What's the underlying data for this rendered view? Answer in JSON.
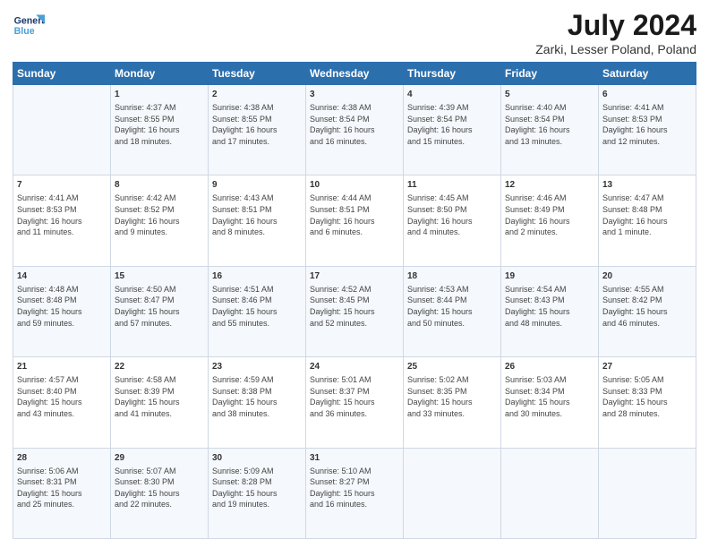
{
  "header": {
    "logo_line1": "General",
    "logo_line2": "Blue",
    "title": "July 2024",
    "subtitle": "Zarki, Lesser Poland, Poland"
  },
  "days_of_week": [
    "Sunday",
    "Monday",
    "Tuesday",
    "Wednesday",
    "Thursday",
    "Friday",
    "Saturday"
  ],
  "weeks": [
    [
      {
        "day": "",
        "content": ""
      },
      {
        "day": "1",
        "content": "Sunrise: 4:37 AM\nSunset: 8:55 PM\nDaylight: 16 hours\nand 18 minutes."
      },
      {
        "day": "2",
        "content": "Sunrise: 4:38 AM\nSunset: 8:55 PM\nDaylight: 16 hours\nand 17 minutes."
      },
      {
        "day": "3",
        "content": "Sunrise: 4:38 AM\nSunset: 8:54 PM\nDaylight: 16 hours\nand 16 minutes."
      },
      {
        "day": "4",
        "content": "Sunrise: 4:39 AM\nSunset: 8:54 PM\nDaylight: 16 hours\nand 15 minutes."
      },
      {
        "day": "5",
        "content": "Sunrise: 4:40 AM\nSunset: 8:54 PM\nDaylight: 16 hours\nand 13 minutes."
      },
      {
        "day": "6",
        "content": "Sunrise: 4:41 AM\nSunset: 8:53 PM\nDaylight: 16 hours\nand 12 minutes."
      }
    ],
    [
      {
        "day": "7",
        "content": "Sunrise: 4:41 AM\nSunset: 8:53 PM\nDaylight: 16 hours\nand 11 minutes."
      },
      {
        "day": "8",
        "content": "Sunrise: 4:42 AM\nSunset: 8:52 PM\nDaylight: 16 hours\nand 9 minutes."
      },
      {
        "day": "9",
        "content": "Sunrise: 4:43 AM\nSunset: 8:51 PM\nDaylight: 16 hours\nand 8 minutes."
      },
      {
        "day": "10",
        "content": "Sunrise: 4:44 AM\nSunset: 8:51 PM\nDaylight: 16 hours\nand 6 minutes."
      },
      {
        "day": "11",
        "content": "Sunrise: 4:45 AM\nSunset: 8:50 PM\nDaylight: 16 hours\nand 4 minutes."
      },
      {
        "day": "12",
        "content": "Sunrise: 4:46 AM\nSunset: 8:49 PM\nDaylight: 16 hours\nand 2 minutes."
      },
      {
        "day": "13",
        "content": "Sunrise: 4:47 AM\nSunset: 8:48 PM\nDaylight: 16 hours\nand 1 minute."
      }
    ],
    [
      {
        "day": "14",
        "content": "Sunrise: 4:48 AM\nSunset: 8:48 PM\nDaylight: 15 hours\nand 59 minutes."
      },
      {
        "day": "15",
        "content": "Sunrise: 4:50 AM\nSunset: 8:47 PM\nDaylight: 15 hours\nand 57 minutes."
      },
      {
        "day": "16",
        "content": "Sunrise: 4:51 AM\nSunset: 8:46 PM\nDaylight: 15 hours\nand 55 minutes."
      },
      {
        "day": "17",
        "content": "Sunrise: 4:52 AM\nSunset: 8:45 PM\nDaylight: 15 hours\nand 52 minutes."
      },
      {
        "day": "18",
        "content": "Sunrise: 4:53 AM\nSunset: 8:44 PM\nDaylight: 15 hours\nand 50 minutes."
      },
      {
        "day": "19",
        "content": "Sunrise: 4:54 AM\nSunset: 8:43 PM\nDaylight: 15 hours\nand 48 minutes."
      },
      {
        "day": "20",
        "content": "Sunrise: 4:55 AM\nSunset: 8:42 PM\nDaylight: 15 hours\nand 46 minutes."
      }
    ],
    [
      {
        "day": "21",
        "content": "Sunrise: 4:57 AM\nSunset: 8:40 PM\nDaylight: 15 hours\nand 43 minutes."
      },
      {
        "day": "22",
        "content": "Sunrise: 4:58 AM\nSunset: 8:39 PM\nDaylight: 15 hours\nand 41 minutes."
      },
      {
        "day": "23",
        "content": "Sunrise: 4:59 AM\nSunset: 8:38 PM\nDaylight: 15 hours\nand 38 minutes."
      },
      {
        "day": "24",
        "content": "Sunrise: 5:01 AM\nSunset: 8:37 PM\nDaylight: 15 hours\nand 36 minutes."
      },
      {
        "day": "25",
        "content": "Sunrise: 5:02 AM\nSunset: 8:35 PM\nDaylight: 15 hours\nand 33 minutes."
      },
      {
        "day": "26",
        "content": "Sunrise: 5:03 AM\nSunset: 8:34 PM\nDaylight: 15 hours\nand 30 minutes."
      },
      {
        "day": "27",
        "content": "Sunrise: 5:05 AM\nSunset: 8:33 PM\nDaylight: 15 hours\nand 28 minutes."
      }
    ],
    [
      {
        "day": "28",
        "content": "Sunrise: 5:06 AM\nSunset: 8:31 PM\nDaylight: 15 hours\nand 25 minutes."
      },
      {
        "day": "29",
        "content": "Sunrise: 5:07 AM\nSunset: 8:30 PM\nDaylight: 15 hours\nand 22 minutes."
      },
      {
        "day": "30",
        "content": "Sunrise: 5:09 AM\nSunset: 8:28 PM\nDaylight: 15 hours\nand 19 minutes."
      },
      {
        "day": "31",
        "content": "Sunrise: 5:10 AM\nSunset: 8:27 PM\nDaylight: 15 hours\nand 16 minutes."
      },
      {
        "day": "",
        "content": ""
      },
      {
        "day": "",
        "content": ""
      },
      {
        "day": "",
        "content": ""
      }
    ]
  ]
}
